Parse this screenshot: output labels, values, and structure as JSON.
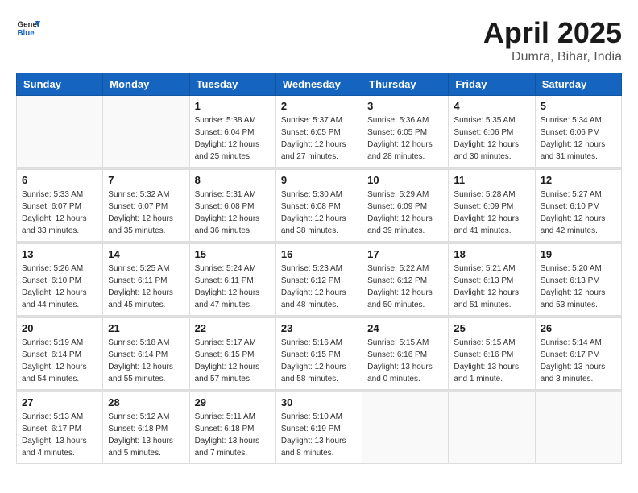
{
  "header": {
    "logo_general": "General",
    "logo_blue": "Blue",
    "title": "April 2025",
    "subtitle": "Dumra, Bihar, India"
  },
  "calendar": {
    "days_of_week": [
      "Sunday",
      "Monday",
      "Tuesday",
      "Wednesday",
      "Thursday",
      "Friday",
      "Saturday"
    ],
    "weeks": [
      [
        {
          "day": "",
          "sunrise": "",
          "sunset": "",
          "daylight": ""
        },
        {
          "day": "",
          "sunrise": "",
          "sunset": "",
          "daylight": ""
        },
        {
          "day": "1",
          "sunrise": "Sunrise: 5:38 AM",
          "sunset": "Sunset: 6:04 PM",
          "daylight": "Daylight: 12 hours and 25 minutes."
        },
        {
          "day": "2",
          "sunrise": "Sunrise: 5:37 AM",
          "sunset": "Sunset: 6:05 PM",
          "daylight": "Daylight: 12 hours and 27 minutes."
        },
        {
          "day": "3",
          "sunrise": "Sunrise: 5:36 AM",
          "sunset": "Sunset: 6:05 PM",
          "daylight": "Daylight: 12 hours and 28 minutes."
        },
        {
          "day": "4",
          "sunrise": "Sunrise: 5:35 AM",
          "sunset": "Sunset: 6:06 PM",
          "daylight": "Daylight: 12 hours and 30 minutes."
        },
        {
          "day": "5",
          "sunrise": "Sunrise: 5:34 AM",
          "sunset": "Sunset: 6:06 PM",
          "daylight": "Daylight: 12 hours and 31 minutes."
        }
      ],
      [
        {
          "day": "6",
          "sunrise": "Sunrise: 5:33 AM",
          "sunset": "Sunset: 6:07 PM",
          "daylight": "Daylight: 12 hours and 33 minutes."
        },
        {
          "day": "7",
          "sunrise": "Sunrise: 5:32 AM",
          "sunset": "Sunset: 6:07 PM",
          "daylight": "Daylight: 12 hours and 35 minutes."
        },
        {
          "day": "8",
          "sunrise": "Sunrise: 5:31 AM",
          "sunset": "Sunset: 6:08 PM",
          "daylight": "Daylight: 12 hours and 36 minutes."
        },
        {
          "day": "9",
          "sunrise": "Sunrise: 5:30 AM",
          "sunset": "Sunset: 6:08 PM",
          "daylight": "Daylight: 12 hours and 38 minutes."
        },
        {
          "day": "10",
          "sunrise": "Sunrise: 5:29 AM",
          "sunset": "Sunset: 6:09 PM",
          "daylight": "Daylight: 12 hours and 39 minutes."
        },
        {
          "day": "11",
          "sunrise": "Sunrise: 5:28 AM",
          "sunset": "Sunset: 6:09 PM",
          "daylight": "Daylight: 12 hours and 41 minutes."
        },
        {
          "day": "12",
          "sunrise": "Sunrise: 5:27 AM",
          "sunset": "Sunset: 6:10 PM",
          "daylight": "Daylight: 12 hours and 42 minutes."
        }
      ],
      [
        {
          "day": "13",
          "sunrise": "Sunrise: 5:26 AM",
          "sunset": "Sunset: 6:10 PM",
          "daylight": "Daylight: 12 hours and 44 minutes."
        },
        {
          "day": "14",
          "sunrise": "Sunrise: 5:25 AM",
          "sunset": "Sunset: 6:11 PM",
          "daylight": "Daylight: 12 hours and 45 minutes."
        },
        {
          "day": "15",
          "sunrise": "Sunrise: 5:24 AM",
          "sunset": "Sunset: 6:11 PM",
          "daylight": "Daylight: 12 hours and 47 minutes."
        },
        {
          "day": "16",
          "sunrise": "Sunrise: 5:23 AM",
          "sunset": "Sunset: 6:12 PM",
          "daylight": "Daylight: 12 hours and 48 minutes."
        },
        {
          "day": "17",
          "sunrise": "Sunrise: 5:22 AM",
          "sunset": "Sunset: 6:12 PM",
          "daylight": "Daylight: 12 hours and 50 minutes."
        },
        {
          "day": "18",
          "sunrise": "Sunrise: 5:21 AM",
          "sunset": "Sunset: 6:13 PM",
          "daylight": "Daylight: 12 hours and 51 minutes."
        },
        {
          "day": "19",
          "sunrise": "Sunrise: 5:20 AM",
          "sunset": "Sunset: 6:13 PM",
          "daylight": "Daylight: 12 hours and 53 minutes."
        }
      ],
      [
        {
          "day": "20",
          "sunrise": "Sunrise: 5:19 AM",
          "sunset": "Sunset: 6:14 PM",
          "daylight": "Daylight: 12 hours and 54 minutes."
        },
        {
          "day": "21",
          "sunrise": "Sunrise: 5:18 AM",
          "sunset": "Sunset: 6:14 PM",
          "daylight": "Daylight: 12 hours and 55 minutes."
        },
        {
          "day": "22",
          "sunrise": "Sunrise: 5:17 AM",
          "sunset": "Sunset: 6:15 PM",
          "daylight": "Daylight: 12 hours and 57 minutes."
        },
        {
          "day": "23",
          "sunrise": "Sunrise: 5:16 AM",
          "sunset": "Sunset: 6:15 PM",
          "daylight": "Daylight: 12 hours and 58 minutes."
        },
        {
          "day": "24",
          "sunrise": "Sunrise: 5:15 AM",
          "sunset": "Sunset: 6:16 PM",
          "daylight": "Daylight: 13 hours and 0 minutes."
        },
        {
          "day": "25",
          "sunrise": "Sunrise: 5:15 AM",
          "sunset": "Sunset: 6:16 PM",
          "daylight": "Daylight: 13 hours and 1 minute."
        },
        {
          "day": "26",
          "sunrise": "Sunrise: 5:14 AM",
          "sunset": "Sunset: 6:17 PM",
          "daylight": "Daylight: 13 hours and 3 minutes."
        }
      ],
      [
        {
          "day": "27",
          "sunrise": "Sunrise: 5:13 AM",
          "sunset": "Sunset: 6:17 PM",
          "daylight": "Daylight: 13 hours and 4 minutes."
        },
        {
          "day": "28",
          "sunrise": "Sunrise: 5:12 AM",
          "sunset": "Sunset: 6:18 PM",
          "daylight": "Daylight: 13 hours and 5 minutes."
        },
        {
          "day": "29",
          "sunrise": "Sunrise: 5:11 AM",
          "sunset": "Sunset: 6:18 PM",
          "daylight": "Daylight: 13 hours and 7 minutes."
        },
        {
          "day": "30",
          "sunrise": "Sunrise: 5:10 AM",
          "sunset": "Sunset: 6:19 PM",
          "daylight": "Daylight: 13 hours and 8 minutes."
        },
        {
          "day": "",
          "sunrise": "",
          "sunset": "",
          "daylight": ""
        },
        {
          "day": "",
          "sunrise": "",
          "sunset": "",
          "daylight": ""
        },
        {
          "day": "",
          "sunrise": "",
          "sunset": "",
          "daylight": ""
        }
      ]
    ]
  }
}
